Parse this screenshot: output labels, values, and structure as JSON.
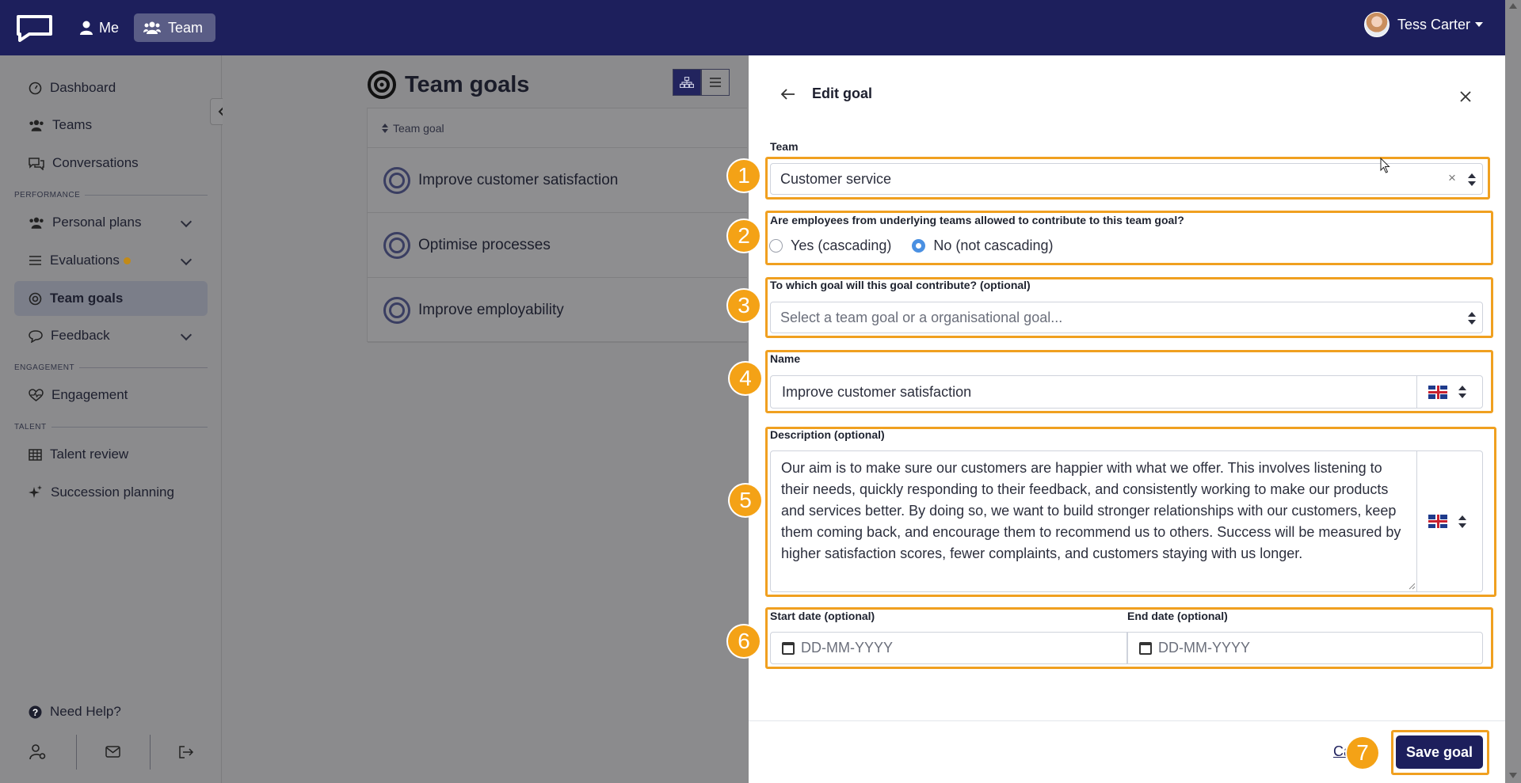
{
  "topbar": {
    "nav_me": "Me",
    "nav_team": "Team",
    "user_name": "Tess Carter"
  },
  "sidebar": {
    "items": [
      {
        "label": "Dashboard",
        "icon": "gauge-icon"
      },
      {
        "label": "Teams",
        "icon": "users-icon"
      },
      {
        "label": "Conversations",
        "icon": "chat-icon"
      },
      {
        "label": "Personal plans",
        "icon": "users-icon"
      },
      {
        "label": "Evaluations",
        "icon": "list-icon"
      },
      {
        "label": "Team goals",
        "icon": "target-icon"
      },
      {
        "label": "Feedback",
        "icon": "speech-bubble-icon"
      },
      {
        "label": "Engagement",
        "icon": "heart-pulse-icon"
      },
      {
        "label": "Talent review",
        "icon": "grid-icon"
      },
      {
        "label": "Succession planning",
        "icon": "sparkles-icon"
      }
    ],
    "sections": {
      "performance": "PERFORMANCE",
      "engagement": "ENGAGEMENT",
      "talent": "TALENT"
    },
    "help": "Need Help?"
  },
  "main": {
    "title": "Team goals",
    "table_header": "Team goal",
    "goals": [
      "Improve customer satisfaction",
      "Optimise processes",
      "Improve employability"
    ]
  },
  "panel": {
    "title": "Edit goal",
    "team_label": "Team",
    "team_value": "Customer service",
    "cascade_question": "Are employees from underlying teams allowed to contribute to this team goal?",
    "cascade_yes": "Yes (cascading)",
    "cascade_no": "No (not cascading)",
    "cascade_selected": "no",
    "contribute_label": "To which goal will this goal contribute? (optional)",
    "contribute_placeholder": "Select a team goal or a organisational goal...",
    "name_label": "Name",
    "name_value": "Improve customer satisfaction",
    "description_label": "Description (optional)",
    "description_value": "Our aim is to make sure our customers are happier with what we offer. This involves listening to their needs, quickly responding to their feedback, and consistently working to make our products and services better. By doing so, we want to build stronger relationships with our customers, keep them coming back, and encourage them to recommend us to others. Success will be measured by higher satisfaction scores, fewer complaints, and customers staying with us longer.",
    "start_label": "Start date (optional)",
    "end_label": "End date (optional)",
    "date_placeholder": "DD-MM-YYYY",
    "cancel_label": "Ca",
    "save_label": "Save goal"
  },
  "annotations": [
    "1",
    "2",
    "3",
    "4",
    "5",
    "6",
    "7"
  ],
  "colors": {
    "brand": "#1d1f5c",
    "highlight": "#f0a020",
    "radio_selected": "#4a90e2"
  }
}
